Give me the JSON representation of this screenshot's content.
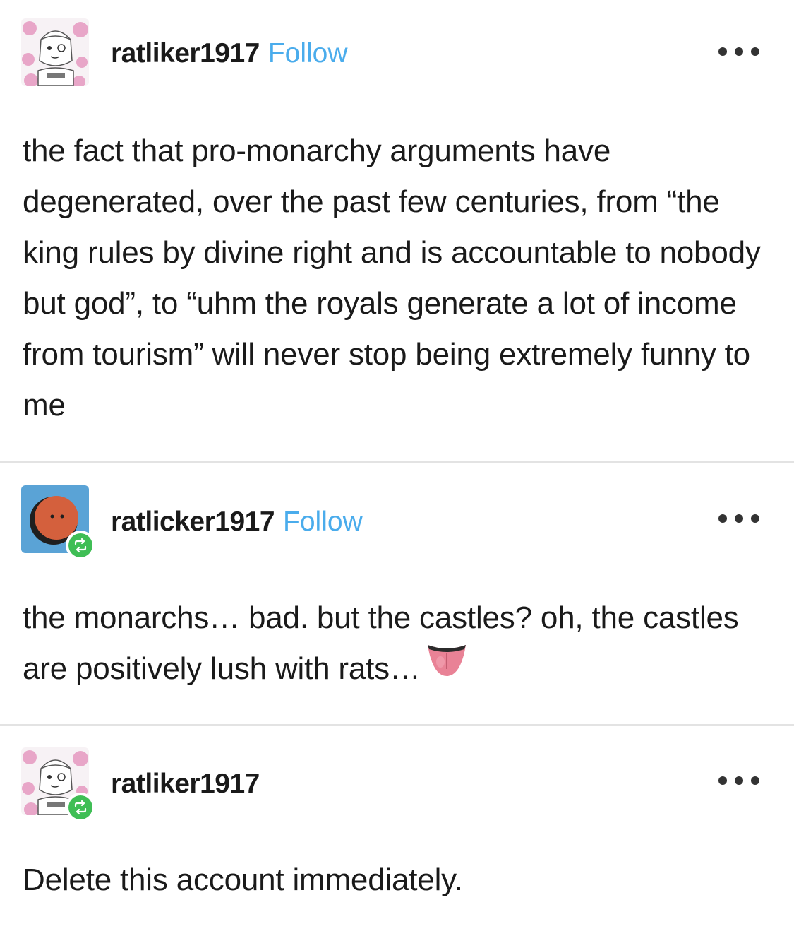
{
  "posts": [
    {
      "username": "ratliker1917",
      "follow_label": "Follow",
      "text": "the fact that pro-monarchy arguments have degenerated, over the past few centuries, from “the king rules by divine right and is accountable to nobody but god”, to “uhm the royals generate a lot of income from tourism” will never stop being extremely funny to me",
      "avatar_icon": "manga-girl-avatar-icon",
      "reblogged": false
    },
    {
      "username": "ratlicker1917",
      "follow_label": "Follow",
      "text": "the monarchs… bad. but the castles? oh, the castles are positively lush with rats…",
      "emoji": "tongue-emoji-icon",
      "avatar_icon": "orange-face-avatar-icon",
      "reblogged": true
    },
    {
      "username": "ratliker1917",
      "text": "Delete this account immediately.",
      "avatar_icon": "manga-girl-avatar-icon",
      "reblogged": true
    }
  ],
  "colors": {
    "follow": "#4aacec",
    "reblog_badge": "#3fbe55",
    "divider": "#e3e3e3",
    "avatar_blue": "#5aa3d6",
    "avatar_orange": "#d4603d",
    "avatar_pink": "#e8a6c8"
  },
  "icons": {
    "more": "more-options-icon",
    "reblog": "reblog-icon"
  }
}
